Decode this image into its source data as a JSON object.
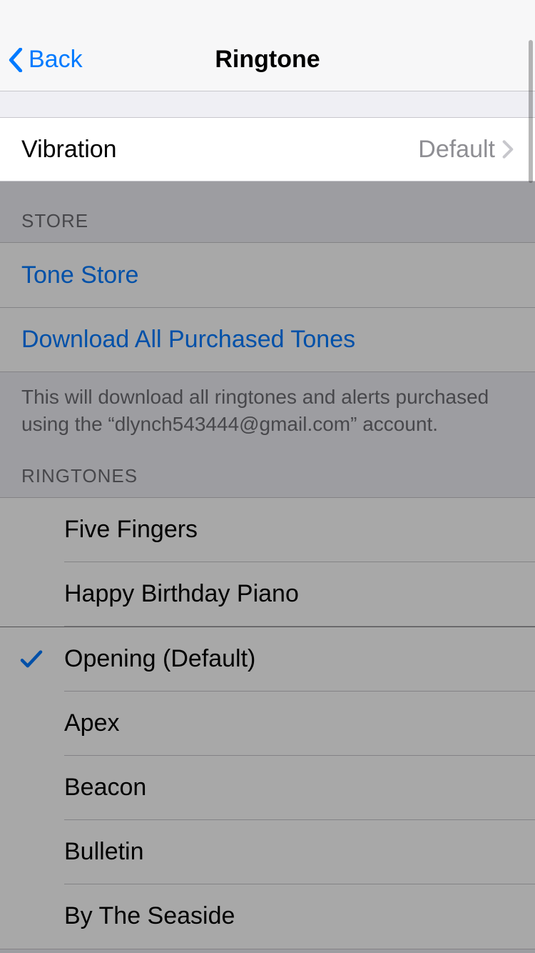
{
  "nav": {
    "back_label": "Back",
    "title": "Ringtone"
  },
  "vibration": {
    "label": "Vibration",
    "value": "Default"
  },
  "store": {
    "header": "STORE",
    "tone_store": "Tone Store",
    "download_all": "Download All Purchased Tones",
    "footer": "This will download all ringtones and alerts purchased using the “dlynch543444@gmail.com” account."
  },
  "ringtones": {
    "header": "RINGTONES",
    "items": [
      {
        "label": "Five Fingers",
        "selected": false
      },
      {
        "label": "Happy Birthday Piano",
        "selected": false
      },
      {
        "label": "Opening (Default)",
        "selected": true
      },
      {
        "label": "Apex",
        "selected": false
      },
      {
        "label": "Beacon",
        "selected": false
      },
      {
        "label": "Bulletin",
        "selected": false
      },
      {
        "label": "By The Seaside",
        "selected": false
      }
    ]
  }
}
